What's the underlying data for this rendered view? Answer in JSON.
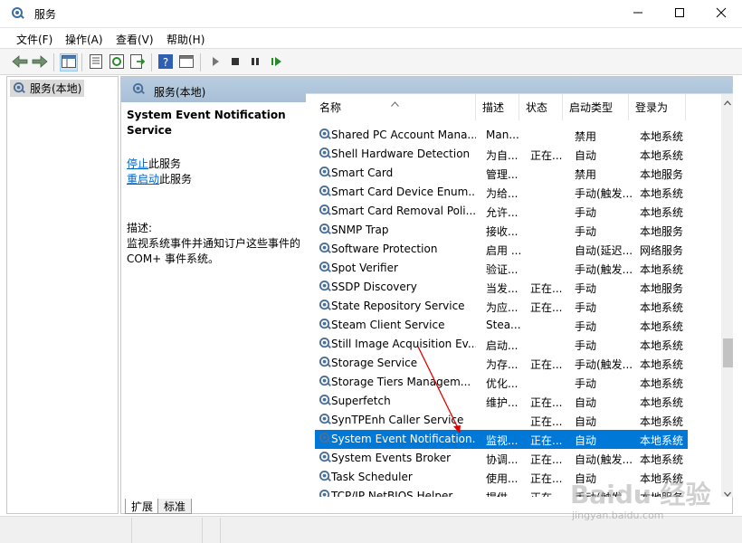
{
  "window": {
    "title": "服务",
    "controls": [
      "minimize-icon",
      "maximize-icon",
      "close-icon"
    ]
  },
  "menu": [
    "文件(F)",
    "操作(A)",
    "查看(V)",
    "帮助(H)"
  ],
  "toolbar_icons": [
    "back-icon",
    "forward-icon",
    "show-hide-tree-icon",
    "properties-icon",
    "refresh-icon",
    "export-list-icon",
    "help-icon",
    "show-pane-icon",
    "start-service-icon",
    "stop-service-icon",
    "pause-service-icon",
    "restart-service-icon"
  ],
  "tree": {
    "node_label": "服务(本地)"
  },
  "panel": {
    "header": "服务(本地)",
    "service_name": "System Event Notification Service",
    "stop_link": "停止",
    "stop_suffix": "此服务",
    "restart_link": "重启动",
    "restart_suffix": "此服务",
    "desc_label": "描述:",
    "desc_text": "监视系统事件并通知订户这些事件的 COM+ 事件系统。"
  },
  "columns": {
    "name": "名称",
    "description": "描述",
    "status": "状态",
    "startup": "启动类型",
    "logon": "登录为"
  },
  "services": [
    {
      "name": "Shared PC Account Mana...",
      "desc": "Man...",
      "status": "",
      "startup": "禁用",
      "logon": "本地系统"
    },
    {
      "name": "Shell Hardware Detection",
      "desc": "为自...",
      "status": "正在...",
      "startup": "自动",
      "logon": "本地系统"
    },
    {
      "name": "Smart Card",
      "desc": "管理...",
      "status": "",
      "startup": "禁用",
      "logon": "本地服务"
    },
    {
      "name": "Smart Card Device Enum...",
      "desc": "为给...",
      "status": "",
      "startup": "手动(触发...",
      "logon": "本地系统"
    },
    {
      "name": "Smart Card Removal Poli...",
      "desc": "允许...",
      "status": "",
      "startup": "手动",
      "logon": "本地系统"
    },
    {
      "name": "SNMP Trap",
      "desc": "接收...",
      "status": "",
      "startup": "手动",
      "logon": "本地服务"
    },
    {
      "name": "Software Protection",
      "desc": "启用 ...",
      "status": "",
      "startup": "自动(延迟...",
      "logon": "网络服务"
    },
    {
      "name": "Spot Verifier",
      "desc": "验证...",
      "status": "",
      "startup": "手动(触发...",
      "logon": "本地系统"
    },
    {
      "name": "SSDP Discovery",
      "desc": "当发...",
      "status": "正在...",
      "startup": "手动",
      "logon": "本地服务"
    },
    {
      "name": "State Repository Service",
      "desc": "为应...",
      "status": "正在...",
      "startup": "手动",
      "logon": "本地系统"
    },
    {
      "name": "Steam Client Service",
      "desc": "Stea...",
      "status": "",
      "startup": "手动",
      "logon": "本地系统"
    },
    {
      "name": "Still Image Acquisition Ev...",
      "desc": "启动...",
      "status": "",
      "startup": "手动",
      "logon": "本地系统"
    },
    {
      "name": "Storage Service",
      "desc": "为存...",
      "status": "正在...",
      "startup": "手动(触发...",
      "logon": "本地系统"
    },
    {
      "name": "Storage Tiers Managem...",
      "desc": "优化...",
      "status": "",
      "startup": "手动",
      "logon": "本地系统"
    },
    {
      "name": "Superfetch",
      "desc": "维护...",
      "status": "正在...",
      "startup": "自动",
      "logon": "本地系统"
    },
    {
      "name": "SynTPEnh Caller Service",
      "desc": "",
      "status": "正在...",
      "startup": "自动",
      "logon": "本地系统"
    },
    {
      "name": "System Event Notification...",
      "desc": "监视...",
      "status": "正在...",
      "startup": "自动",
      "logon": "本地系统",
      "selected": true
    },
    {
      "name": "System Events Broker",
      "desc": "协调...",
      "status": "正在...",
      "startup": "自动(触发...",
      "logon": "本地系统"
    },
    {
      "name": "Task Scheduler",
      "desc": "使用...",
      "status": "正在...",
      "startup": "自动",
      "logon": "本地系统"
    },
    {
      "name": "TCP/IP NetBIOS Helper",
      "desc": "提供...",
      "status": "正在...",
      "startup": "手动(触发...",
      "logon": "本地服务"
    }
  ],
  "tabs": [
    "扩展",
    "标准"
  ],
  "watermark": {
    "main": "Baidu 经验",
    "sub": "jingyan.baidu.com"
  },
  "colors": {
    "selected_row": "#0078d7",
    "link": "#0066cc",
    "panel_header": "#b8cde0",
    "annotation_arrow": "#e00000"
  }
}
